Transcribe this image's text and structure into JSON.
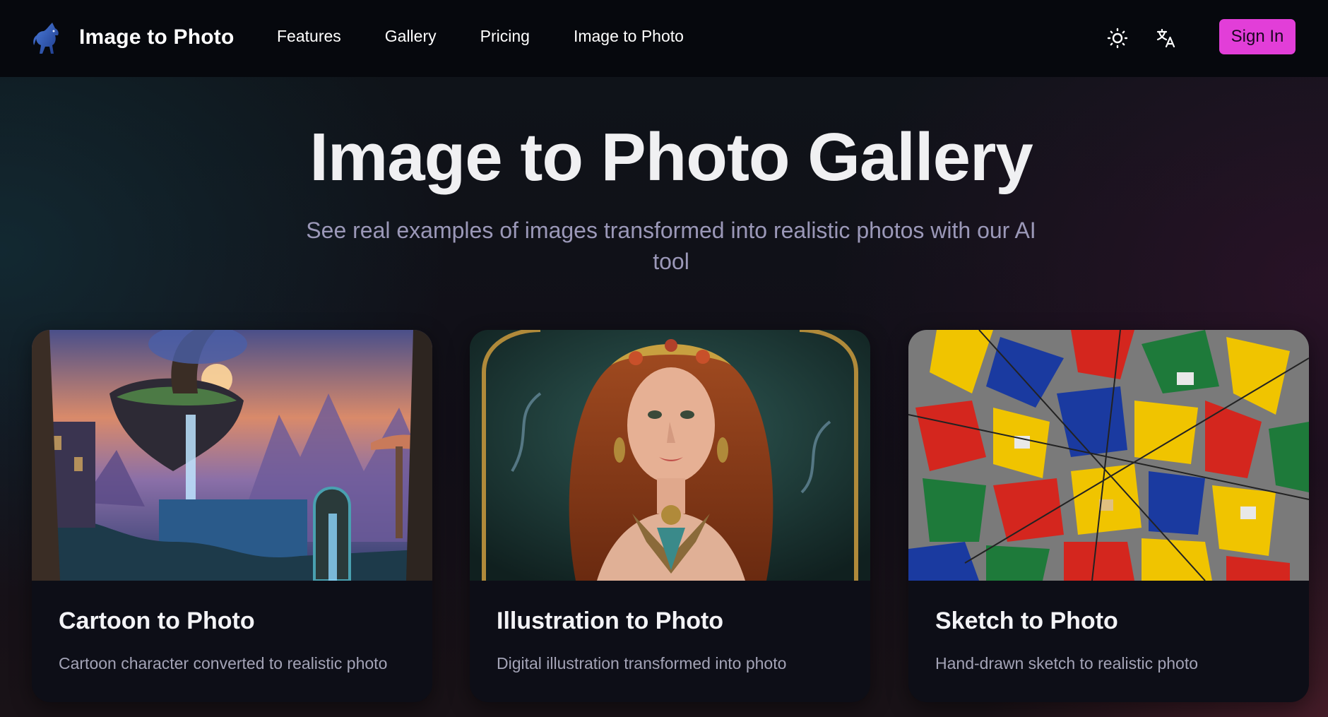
{
  "header": {
    "brand": "Image to Photo",
    "logo_icon": "unicorn-icon",
    "nav": [
      {
        "label": "Features"
      },
      {
        "label": "Gallery"
      },
      {
        "label": "Pricing"
      },
      {
        "label": "Image to Photo"
      }
    ],
    "theme_icon": "sun-icon",
    "language_icon": "translate-icon",
    "sign_in": "Sign In",
    "accent": "#e23ed8"
  },
  "hero": {
    "title": "Image to Photo Gallery",
    "subtitle": "See real examples of images transformed into realistic photos with our AI tool"
  },
  "cards": [
    {
      "title": "Cartoon to Photo",
      "description": "Cartoon character converted to realistic photo"
    },
    {
      "title": "Illustration to Photo",
      "description": "Digital illustration transformed into photo"
    },
    {
      "title": "Sketch to Photo",
      "description": "Hand-drawn sketch to realistic photo"
    }
  ]
}
